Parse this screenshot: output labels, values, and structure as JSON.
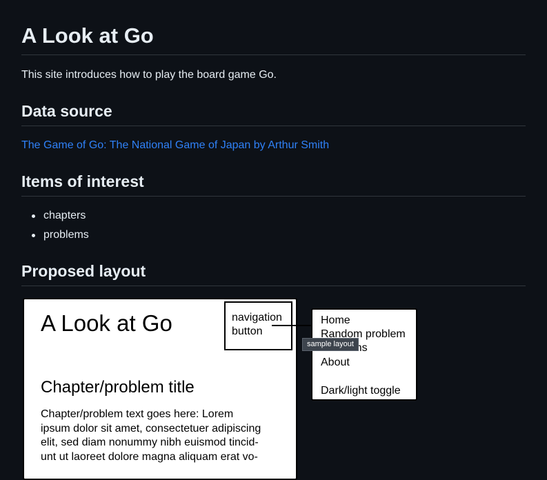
{
  "page": {
    "title": "A Look at Go",
    "intro": "This site introduces how to play the board game Go."
  },
  "data_source": {
    "heading": "Data source",
    "link_text": "The Game of Go: The National Game of Japan by Arthur Smith"
  },
  "items_of_interest": {
    "heading": "Items of interest",
    "items": [
      "chapters",
      "problems"
    ]
  },
  "proposed_layout": {
    "heading": "Proposed layout",
    "image_tooltip": "sample layout",
    "sketch": {
      "site_title": "A Look at Go",
      "nav_button_line1": "navigation",
      "nav_button_line2": "button",
      "menu_items": [
        "Home",
        "Random problem",
        "Problems",
        "About",
        "Dark/light toggle"
      ],
      "chapter_title": "Chapter/problem title",
      "body_lines": [
        "Chapter/problem text goes here: Lorem",
        "ipsum dolor sit amet, consectetuer adipiscing",
        "elit, sed diam nonummy nibh euismod tincid-",
        "unt ut laoreet dolore magna aliquam erat vo-"
      ]
    }
  },
  "colors": {
    "background": "#0d1117",
    "text": "#e6edf3",
    "link": "#2f81f7",
    "rule": "#30363d"
  }
}
